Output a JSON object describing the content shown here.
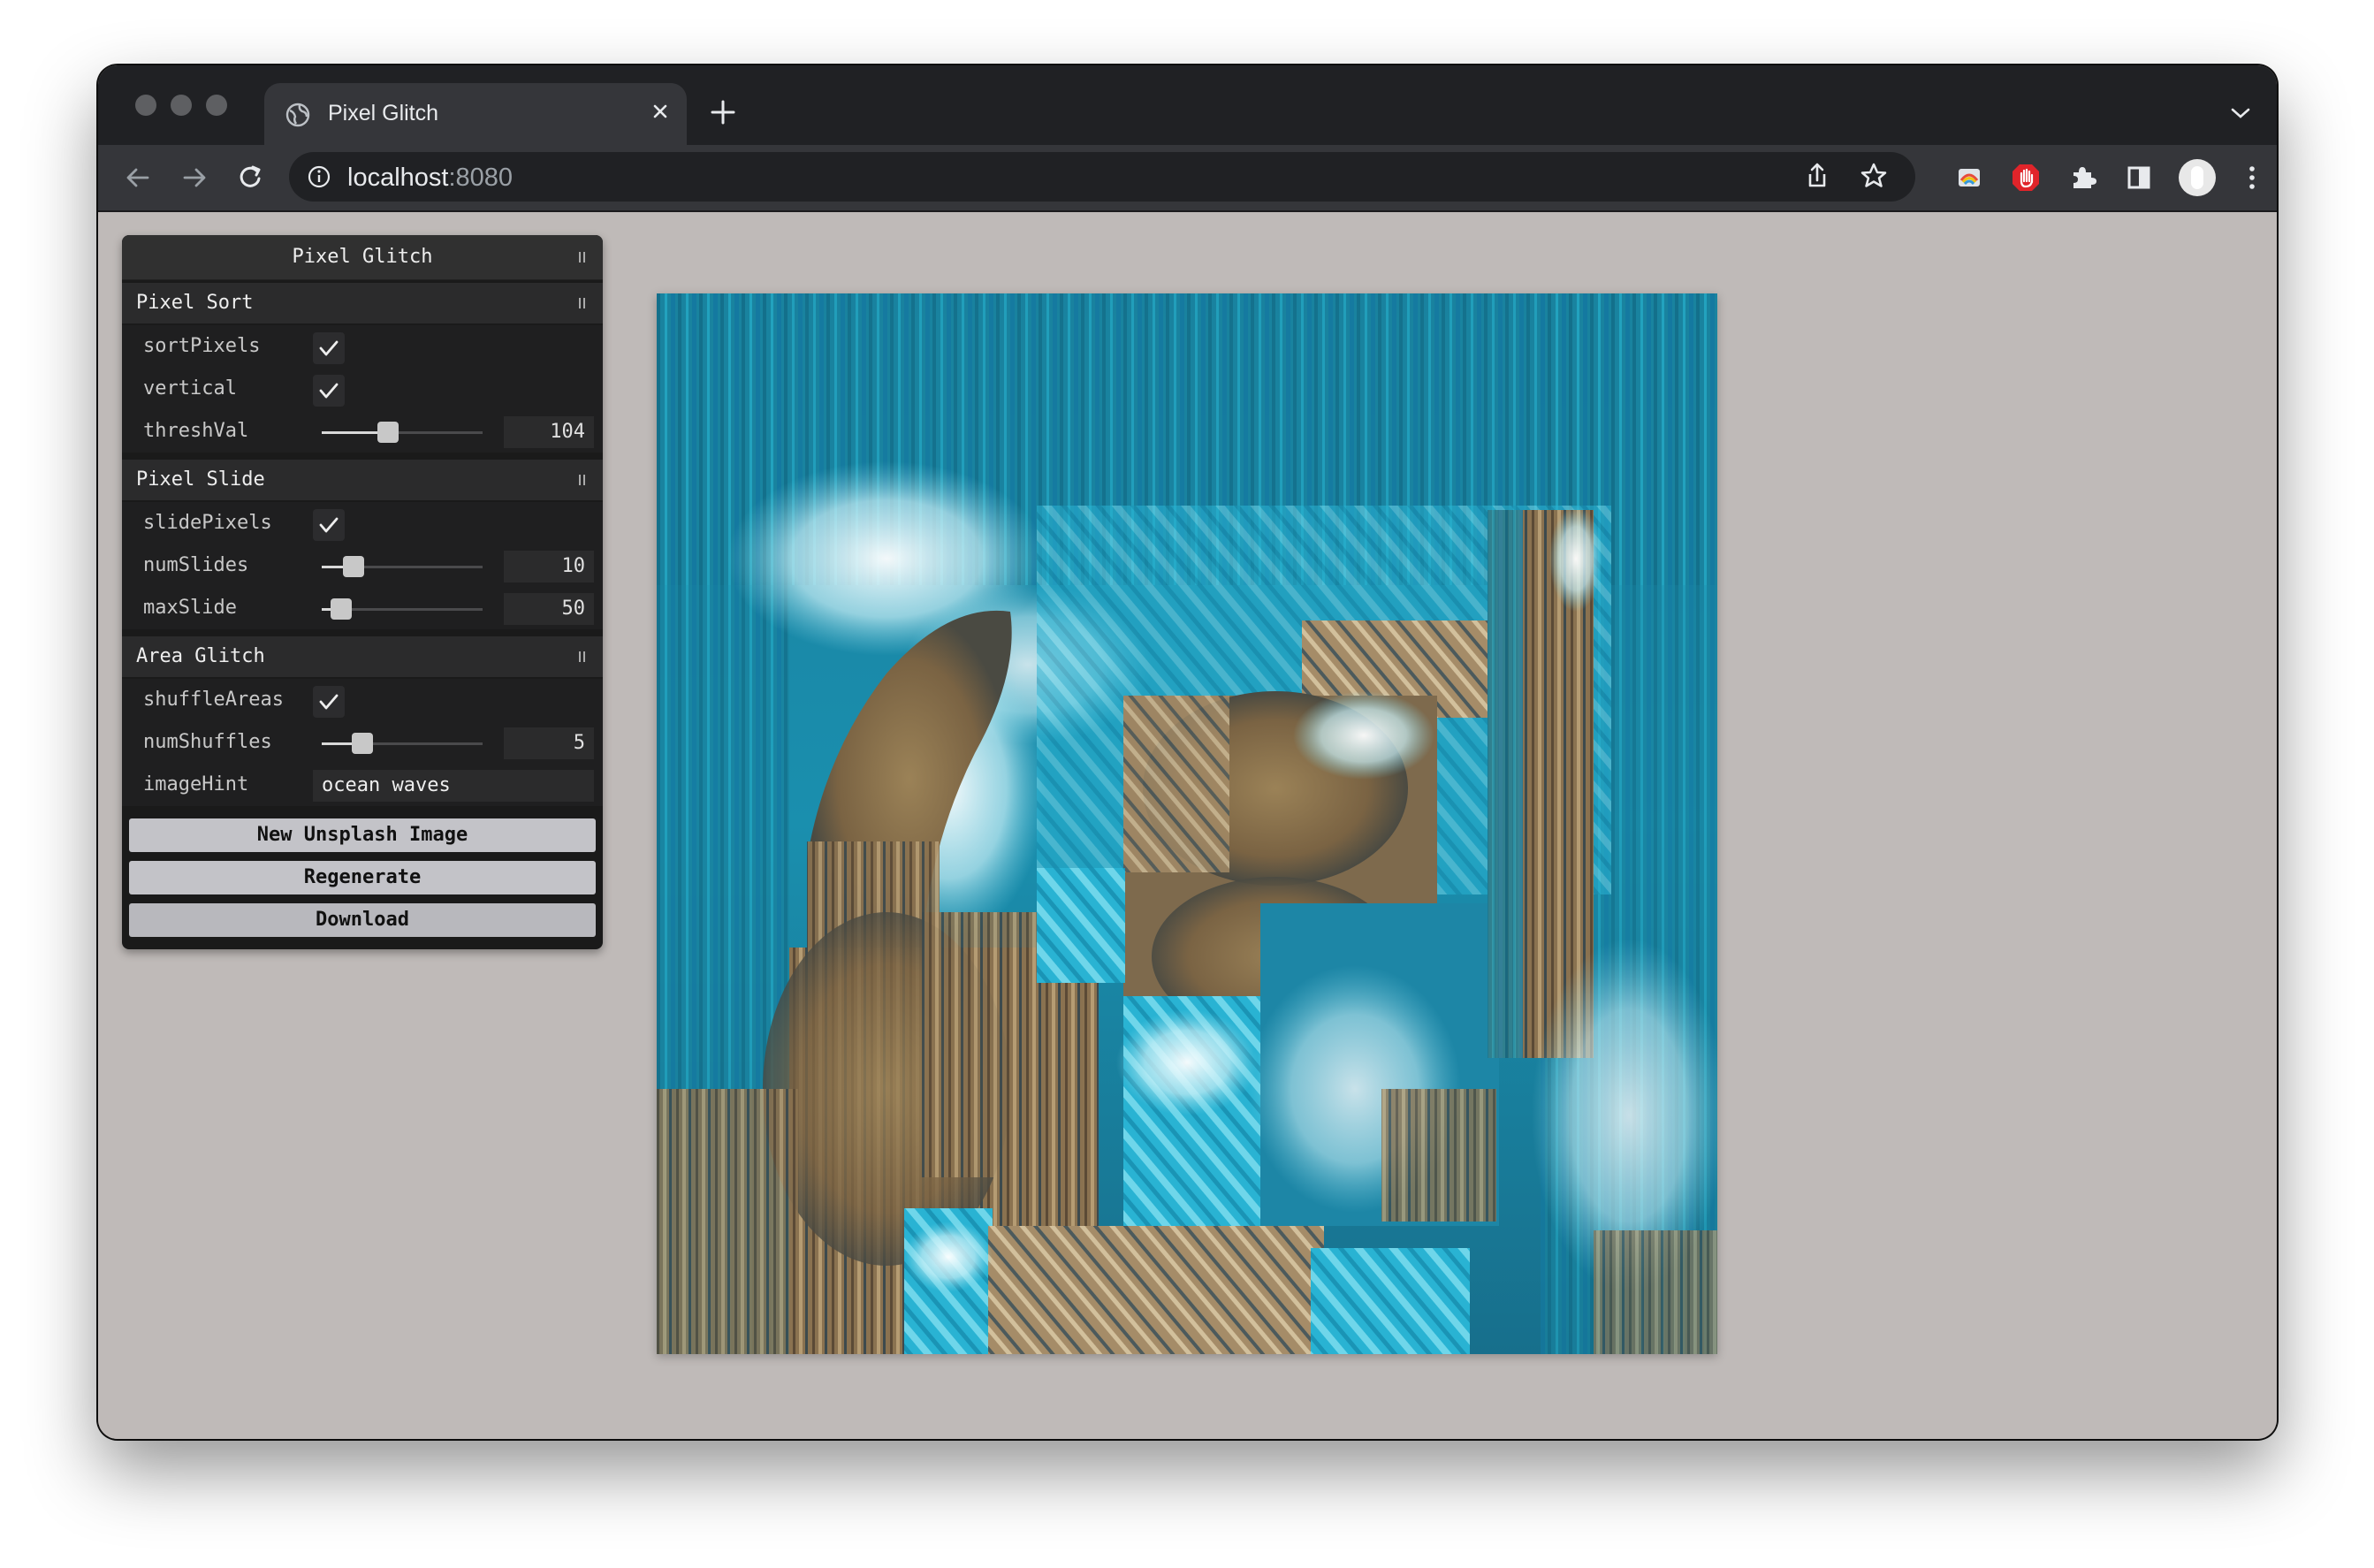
{
  "browser": {
    "tab_title": "Pixel Glitch",
    "url_host": "localhost",
    "url_port": ":8080"
  },
  "gui": {
    "title": "Pixel Glitch",
    "folders": {
      "pixel_sort": {
        "title": "Pixel Sort",
        "sortPixels_label": "sortPixels",
        "sortPixels_checked": true,
        "vertical_label": "vertical",
        "vertical_checked": true,
        "threshVal_label": "threshVal",
        "threshVal_value": "104",
        "threshVal_fraction": 0.41
      },
      "pixel_slide": {
        "title": "Pixel Slide",
        "slidePixels_label": "slidePixels",
        "slidePixels_checked": true,
        "numSlides_label": "numSlides",
        "numSlides_value": "10",
        "numSlides_fraction": 0.2,
        "maxSlide_label": "maxSlide",
        "maxSlide_value": "50",
        "maxSlide_fraction": 0.12
      },
      "area_glitch": {
        "title": "Area Glitch",
        "shuffleAreas_label": "shuffleAreas",
        "shuffleAreas_checked": true,
        "numShuffles_label": "numShuffles",
        "numShuffles_value": "5",
        "numShuffles_fraction": 0.25,
        "imageHint_label": "imageHint",
        "imageHint_value": "ocean waves"
      }
    },
    "buttons": {
      "new_image": "New Unsplash Image",
      "regenerate": "Regenerate",
      "download": "Download"
    }
  },
  "colors": {
    "chrome_dark": "#202124",
    "chrome_toolbar": "#35363a",
    "page_bg": "#bfbab8",
    "ocean": "#1b87a8",
    "rock": "#8d7553"
  }
}
